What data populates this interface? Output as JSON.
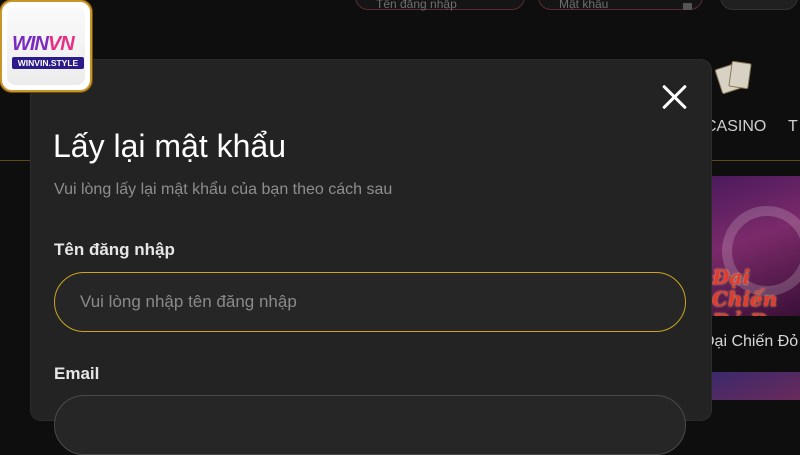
{
  "background": {
    "header": {
      "username_placeholder": "Tên đăng nhập",
      "password_placeholder": "Mật khẩu",
      "login_button": ""
    },
    "nav": {
      "casino_label": "CASINO",
      "next_label": "T"
    },
    "promo": {
      "banner_title": "Đại Chiến Đỏ Đen",
      "caption": "Đại Chiến Đỏ"
    }
  },
  "logo": {
    "brand_part1": "WIN",
    "brand_part2": "VN",
    "site": "WINVIN.STYLE"
  },
  "modal": {
    "title": "Lấy lại mật khẩu",
    "subtitle": "Vui lòng lấy lại mật khẩu của bạn theo cách sau",
    "username_label": "Tên đăng nhập",
    "username_placeholder": "Vui lòng nhập tên đăng nhập",
    "email_label": "Email",
    "close_icon": "close-icon"
  },
  "colors": {
    "accent_gold": "#c9a522",
    "modal_bg": "#232323",
    "page_bg": "#0e0e0e"
  }
}
